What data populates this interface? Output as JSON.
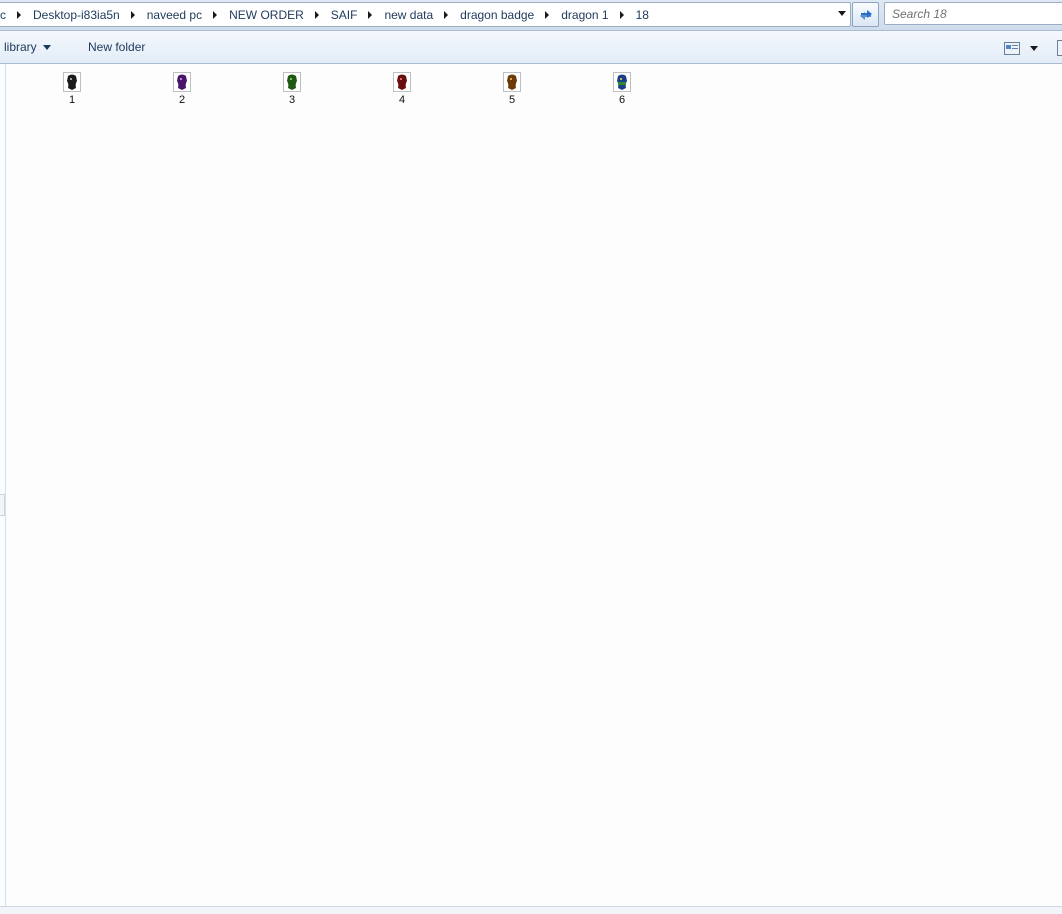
{
  "address": {
    "crumbs": [
      "c",
      "Desktop-i83ia5n",
      "naveed pc",
      "NEW ORDER",
      "SAIF",
      "new data",
      "dragon badge",
      "dragon 1",
      "18"
    ],
    "history_dropdown_icon": "chevron-down-icon",
    "refresh_icon": "refresh-icon"
  },
  "search": {
    "placeholder": "Search 18"
  },
  "toolbar": {
    "include_library_label": "n library",
    "new_folder_label": "New folder",
    "view_icon": "view-options-icon"
  },
  "files": [
    {
      "name": "1",
      "color": "#1b1b1b"
    },
    {
      "name": "2",
      "color": "#4a1468"
    },
    {
      "name": "3",
      "color": "#1f5a12"
    },
    {
      "name": "4",
      "color": "#6a0d0d"
    },
    {
      "name": "5",
      "color": "#6b3a08"
    },
    {
      "name": "6",
      "color": "#1c3f8a"
    }
  ]
}
